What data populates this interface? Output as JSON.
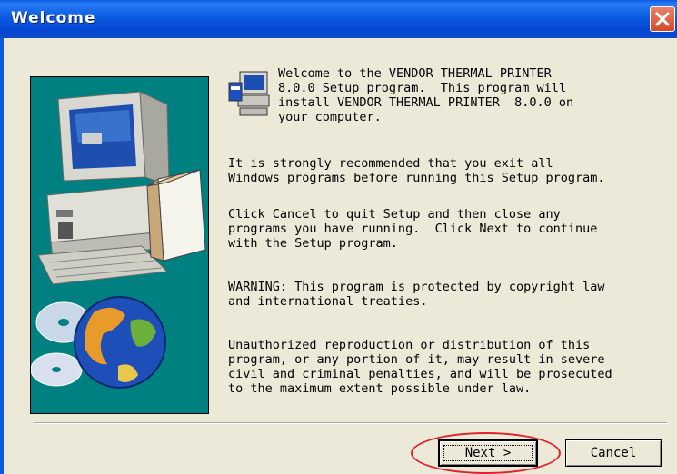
{
  "window": {
    "title": "Welcome",
    "close_icon": "close-icon"
  },
  "content": {
    "paragraphs": [
      "Welcome to the VENDOR THERMAL PRINTER\n8.0.0 Setup program.  This program will\ninstall VENDOR THERMAL PRINTER  8.0.0 on\nyour computer.",
      "It is strongly recommended that you exit all\nWindows programs before running this Setup program.",
      "Click Cancel to quit Setup and then close any\nprograms you have running.  Click Next to continue\nwith the Setup program.",
      "WARNING: This program is protected by copyright law\nand international treaties.",
      "Unauthorized reproduction or distribution of this\nprogram, or any portion of it, may result in severe\ncivil and criminal penalties, and will be prosecuted\nto the maximum extent possible under law."
    ]
  },
  "buttons": {
    "next_label": "Next >",
    "cancel_label": "Cancel"
  },
  "colors": {
    "titlebar": "#0A5BE0",
    "dialog_bg": "#ECE9D8",
    "illustration_bg": "#008080",
    "highlight": "#E0202A"
  },
  "icons": [
    "setup-computer-icon",
    "close-icon"
  ]
}
